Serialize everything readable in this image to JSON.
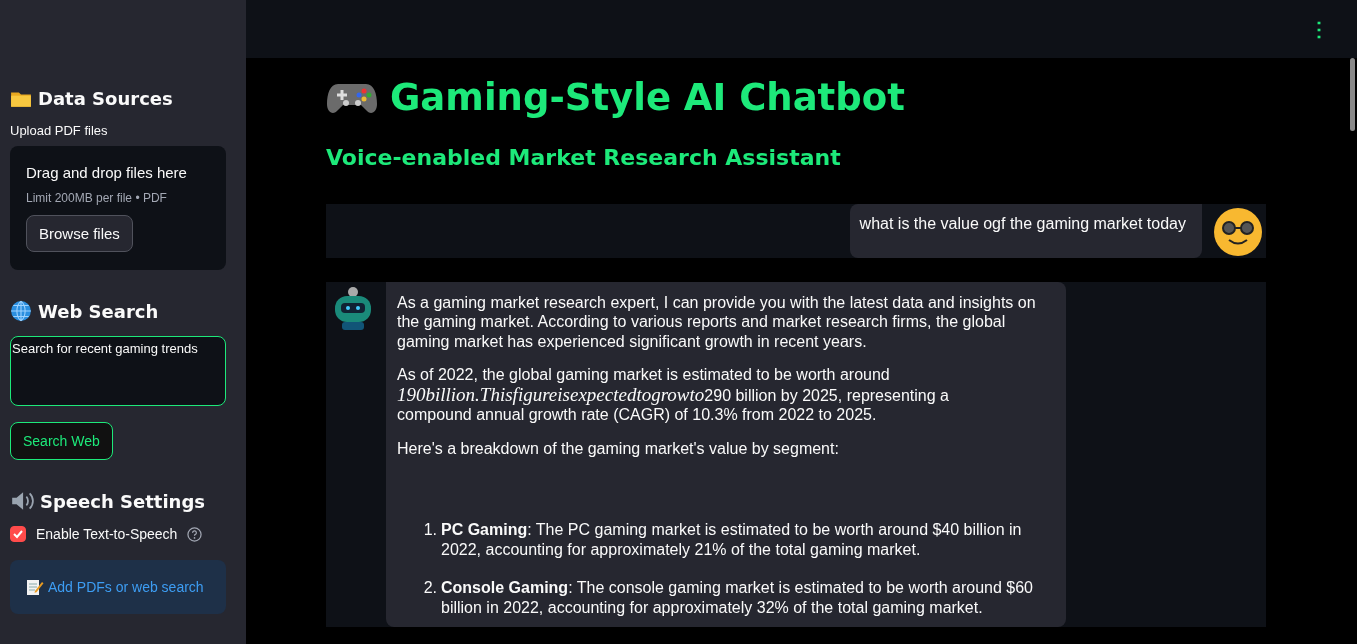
{
  "sidebar": {
    "sections": [
      {
        "kind": "upload",
        "title": "Data Sources",
        "label": "Upload PDF files",
        "dropzone": {
          "title": "Drag and drop files here",
          "hint": "Limit 200MB per file • PDF",
          "button": "Browse files"
        }
      },
      {
        "kind": "search",
        "title": "Web Search",
        "field": {
          "value": "Search for recent gaming trends"
        },
        "button": "Search Web"
      },
      {
        "kind": "speech",
        "title": "Speech Settings",
        "checkbox": {
          "label": "Enable Text-to-Speech",
          "checked": true
        },
        "info": "Add PDFs or web search"
      }
    ]
  },
  "header": {
    "menu_icon": "⋮"
  },
  "main": {
    "title": "Gaming-Style AI Chatbot",
    "subtitle": "Voice-enabled Market Research Assistant",
    "messages": [
      {
        "kind": "user",
        "paragraphs": [
          {
            "parts": [
              {
                "text": "what is the value ogf the gaming market today",
                "math": false
              }
            ]
          }
        ]
      },
      {
        "kind": "assistant",
        "paragraphs": [
          {
            "parts": [
              {
                "text": "As a gaming market research expert, I can provide you with the latest data and insights on the gaming market. According to various reports and market research firms, the global gaming market has experienced significant growth in recent years.",
                "math": false
              }
            ]
          },
          {
            "parts": [
              {
                "text": "As of 2022, the global gaming market is estimated to be worth around ",
                "math": false
              },
              {
                "text": "190billion.Thisfigureisexpectedtogrowto",
                "math": true
              },
              {
                "text": "290 billion by 2025, representing a",
                "math": false
              },
              {
                "text": "compound annual growth rate (CAGR) of 10.3% from 2022 to 2025.",
                "math": false
              }
            ]
          },
          {
            "parts": [
              {
                "text": "Here's a breakdown of the gaming market's value by segment:",
                "math": false
              }
            ]
          }
        ],
        "list": [
          {
            "number": "1.",
            "text": "**PC Gaming**: The PC gaming market is estimated to be worth around $40 billion in 2022, accounting for approximately 21% of the total gaming market."
          },
          {
            "number": "2.",
            "text": "**Console Gaming**: The console gaming market is estimated to be worth around $60 billion in 2022, accounting for approximately 32% of the total gaming market."
          }
        ]
      }
    ]
  }
}
